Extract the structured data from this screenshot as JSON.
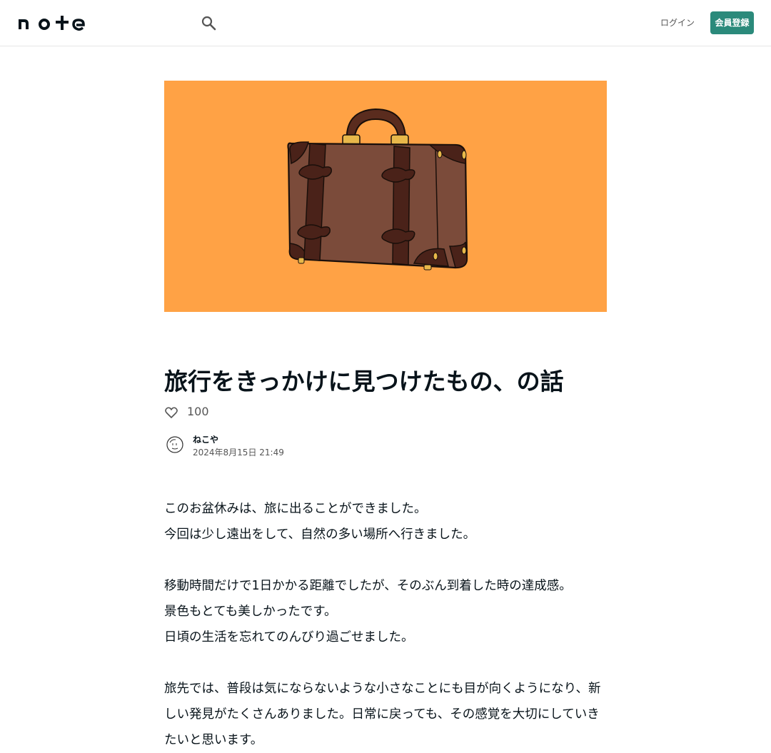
{
  "header": {
    "logo_text": "note",
    "login_label": "ログイン",
    "signup_label": "会員登録"
  },
  "hero": {
    "image_alt": "brown-suitcase-illustration",
    "background": "#ffa245"
  },
  "article": {
    "title": "旅行をきっかけに見つけたもの、の話",
    "like_count": "100",
    "author_name": "ねこや",
    "date": "2024年8月15日 21:49",
    "paragraphs": [
      "このお盆休みは、旅に出ることができました。",
      "今回は少し遠出をして、自然の多い場所へ行きました。",
      "",
      "移動時間だけで1日かかる距離でしたが、そのぶん到着した時の達成感。",
      "景色もとても美しかったです。",
      "日頃の生活を忘れてのんびり過ごせました。",
      "",
      "旅先では、普段は気にならないような小さなことにも目が向くようになり、新しい発見がたくさんありました。日常に戻っても、その感覚を大切にしていきたいと思います。"
    ]
  },
  "colors": {
    "accent": "#2b8a7b",
    "text": "#08131a",
    "muted": "#555555"
  }
}
